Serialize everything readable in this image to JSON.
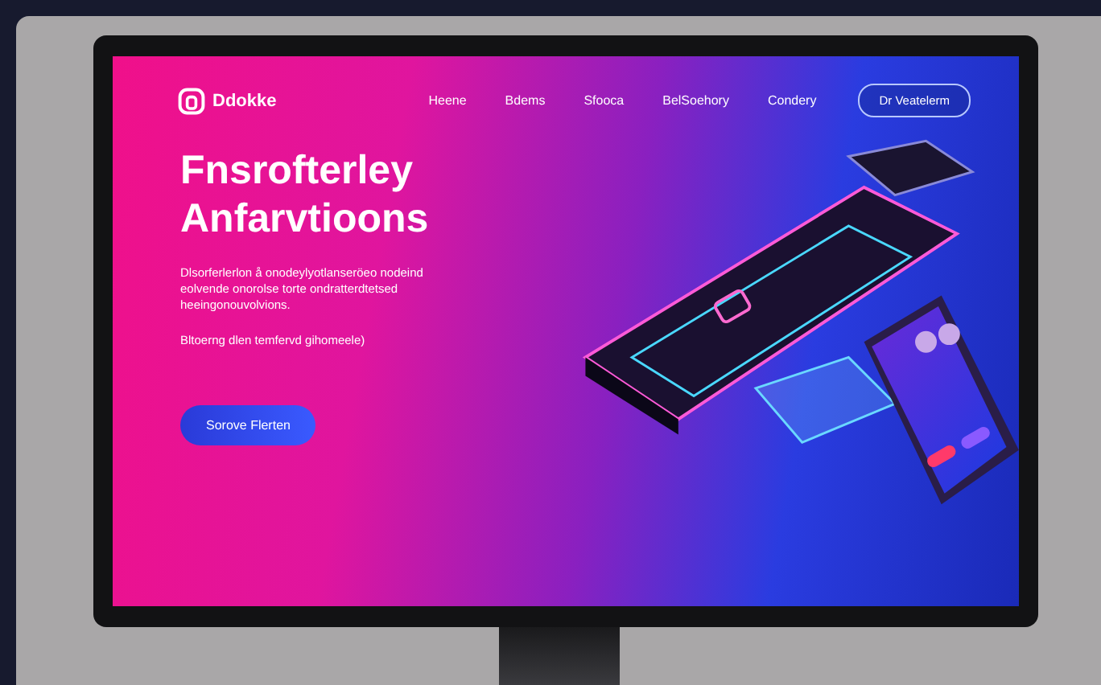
{
  "site": {
    "logo": "Ddokke"
  },
  "nav": {
    "links": [
      {
        "label": "Heene"
      },
      {
        "label": "Bdems"
      },
      {
        "label": "Sfooca"
      },
      {
        "label": "BelSoehory"
      },
      {
        "label": "Condery"
      }
    ],
    "cta": "Dr Veatelerm"
  },
  "hero": {
    "title_lines": [
      "Fnsrofterley",
      "Anfarvtioons"
    ],
    "paragraph": "Dlsorferlerlon å onodeylyotlanseröeo nodeind eolvende onorolse torte ondratterdtetsed heeingonouvolvions.",
    "note": "Bltoerng dlen temfervd gihomeele)",
    "button": "Sorove Flerten"
  }
}
